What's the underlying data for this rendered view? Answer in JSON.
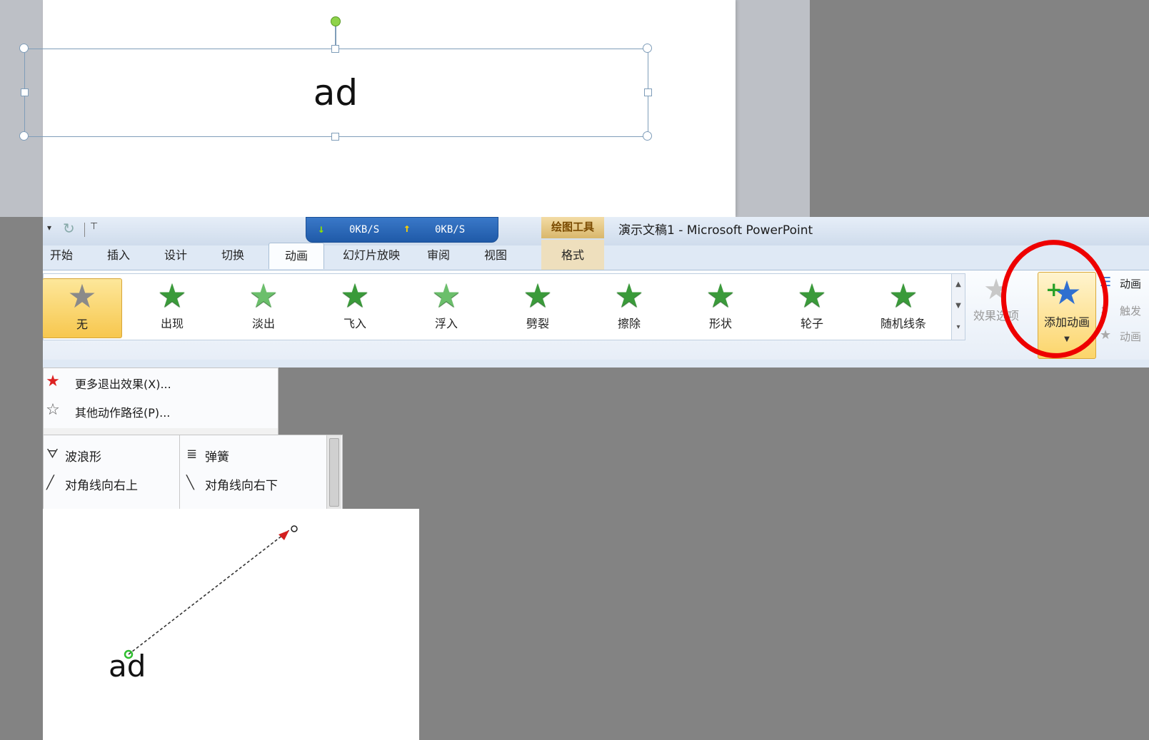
{
  "slide_top": {
    "text": "ad"
  },
  "window": {
    "title": "演示文稿1 - Microsoft PowerPoint",
    "contextual_group": "绘图工具"
  },
  "network_speed": {
    "download": "0KB/S",
    "upload": "0KB/S"
  },
  "tabs": [
    {
      "label": "开始"
    },
    {
      "label": "插入"
    },
    {
      "label": "设计"
    },
    {
      "label": "切换"
    },
    {
      "label": "动画",
      "active": true
    },
    {
      "label": "幻灯片放映"
    },
    {
      "label": "审阅"
    },
    {
      "label": "视图"
    },
    {
      "label": "格式"
    }
  ],
  "gallery": {
    "effects": [
      {
        "label": "无",
        "selected": true,
        "icon": "gray-star-icon"
      },
      {
        "label": "出现",
        "icon": "star-appear-icon"
      },
      {
        "label": "淡出",
        "icon": "star-fade-icon"
      },
      {
        "label": "飞入",
        "icon": "star-fly-in-icon"
      },
      {
        "label": "浮入",
        "icon": "star-float-in-icon"
      },
      {
        "label": "劈裂",
        "icon": "star-split-icon"
      },
      {
        "label": "擦除",
        "icon": "star-wipe-icon"
      },
      {
        "label": "形状",
        "icon": "star-shape-icon"
      },
      {
        "label": "轮子",
        "icon": "star-wheel-icon"
      },
      {
        "label": "随机线条",
        "icon": "star-random-bars-icon"
      }
    ]
  },
  "effect_options": {
    "label": "效果选项"
  },
  "add_animation": {
    "label": "添加动画"
  },
  "side_commands": {
    "pane": "动画",
    "trigger": "触发",
    "painter": "动画"
  },
  "menu1": {
    "items": [
      {
        "label": "更多退出效果(X)...",
        "icon": "red-star-icon"
      },
      {
        "label": "其他动作路径(P)...",
        "icon": "outline-star-icon"
      }
    ]
  },
  "menu2": {
    "left": [
      {
        "label": "波浪形",
        "icon": "wave-icon"
      },
      {
        "label": "对角线向右上",
        "icon": "diagonal-up-right-icon"
      }
    ],
    "right": [
      {
        "label": "弹簧",
        "icon": "spring-icon"
      },
      {
        "label": "对角线向右下",
        "icon": "diagonal-down-right-icon"
      }
    ]
  },
  "slide_bottom": {
    "text": "ad"
  },
  "colors": {
    "accent_red": "#ee0000",
    "star_green": "#3a9a3a",
    "selected_yellow": "#f7c74e",
    "add_star_blue": "#2f6fd0"
  }
}
